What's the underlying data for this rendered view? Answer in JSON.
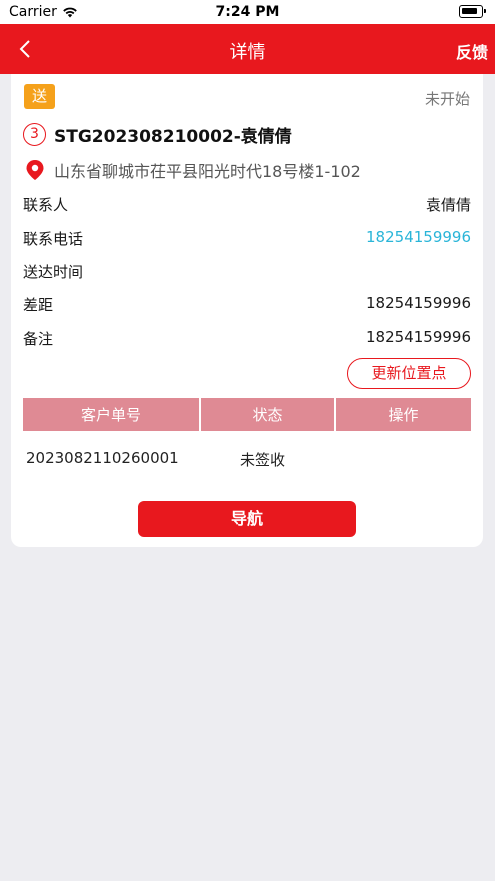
{
  "status_bar": {
    "carrier": "Carrier",
    "time": "7:24 PM"
  },
  "nav": {
    "back_icon": "chevron-left-icon",
    "title": "详情",
    "feedback": "反馈"
  },
  "card": {
    "tag": "送",
    "status": "未开始",
    "order_index": "3",
    "order_title": "STG202308210002-袁倩倩",
    "address": "山东省聊城市茌平县阳光时代18号楼1-102",
    "fields": [
      {
        "label": "联系人",
        "value": "袁倩倩"
      },
      {
        "label": "联系电话",
        "value": "18254159996"
      },
      {
        "label": "送达时间",
        "value": ""
      },
      {
        "label": "差距",
        "value": "18254159996"
      },
      {
        "label": "备注",
        "value": "18254159996"
      }
    ],
    "update_location": "更新位置点",
    "table": {
      "headers": [
        "客户单号",
        "状态",
        "操作"
      ],
      "rows": [
        {
          "customer_no": "2023082110260001",
          "status": "未签收",
          "action": ""
        }
      ]
    },
    "navigate": "导航"
  },
  "colors": {
    "primary": "#e8181e",
    "tag": "#f5a11b",
    "link": "#2ab5d8",
    "table_header": "#df8a94"
  }
}
